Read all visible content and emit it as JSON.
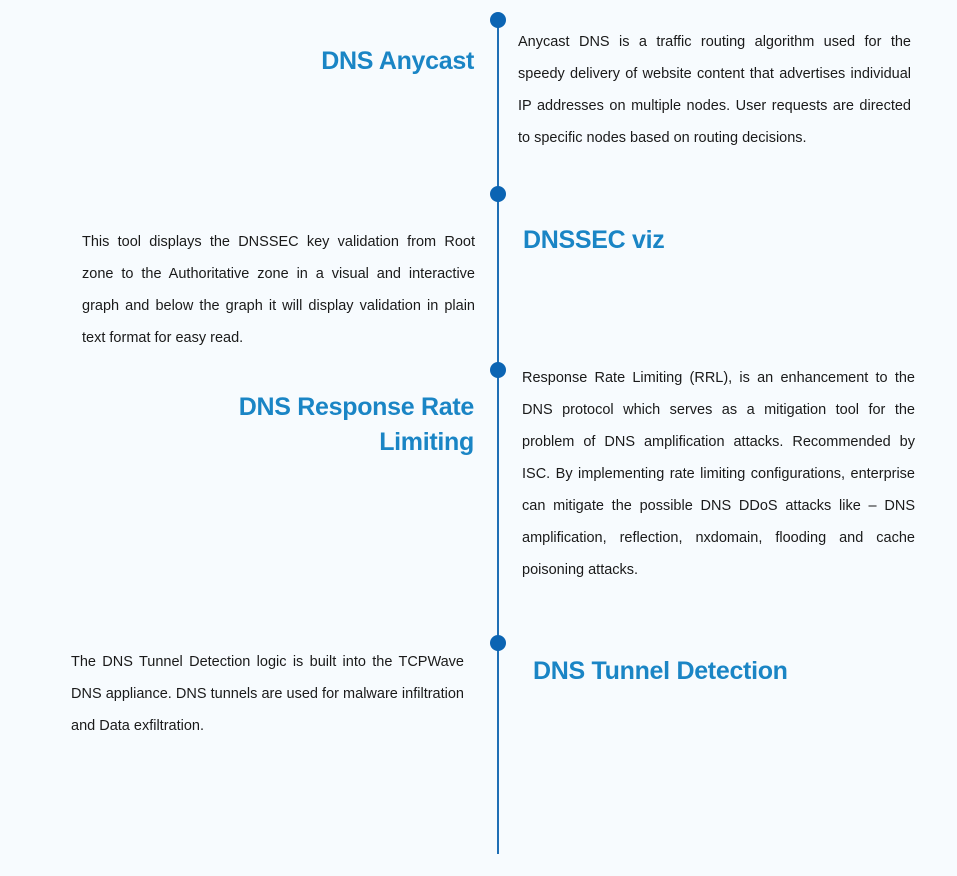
{
  "timeline": {
    "items": [
      {
        "title": "DNS Anycast",
        "description": "Anycast DNS is a traffic routing algorithm used for the speedy delivery of website content that advertises individual IP addresses on multiple nodes. User requests are directed to specific nodes based on routing decisions."
      },
      {
        "title": "DNSSEC viz",
        "description": "This tool displays the DNSSEC key validation from Root zone to the Authoritative zone in a visual and interactive graph and below the graph it will display validation in plain text format for easy read."
      },
      {
        "title": "DNS Response Rate Limiting",
        "description": "Response Rate Limiting (RRL), is an enhancement to the DNS protocol which serves as a mitigation tool for the problem of DNS amplification attacks. Recommended by ISC. By implementing rate limiting configurations, enterprise can mitigate the possible DNS DDoS attacks like – DNS amplification, reflection, nxdomain, flooding and cache poisoning attacks."
      },
      {
        "title": "DNS Tunnel Detection",
        "description": "The DNS Tunnel Detection logic is built into the TCPWave DNS appliance. DNS tunnels are used for malware infiltration and Data exfiltration."
      }
    ]
  }
}
